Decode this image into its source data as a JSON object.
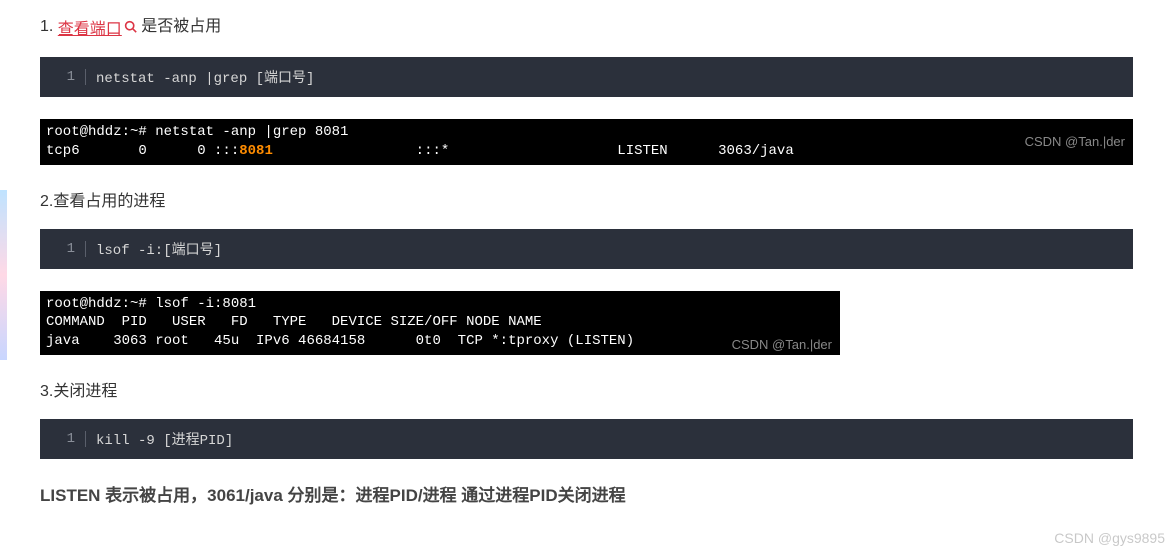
{
  "step1": {
    "num": "1. ",
    "link_text": "查看端口",
    "after_text": " 是否被占用",
    "icon_name": "search-icon"
  },
  "code1": {
    "lineno": "1",
    "code": "netstat -anp |grep [端口号]"
  },
  "term1": {
    "line1_prefix": "root@hddz:~# netstat -anp |grep 8081",
    "line2_before": "tcp6       0      0 :::",
    "line2_highlight": "8081",
    "line2_after": "                 :::*                    LISTEN      3063/java",
    "watermark": "CSDN @Tan.|der"
  },
  "step2": "2.查看占用的进程",
  "code2": {
    "lineno": "1",
    "code": "lsof -i:[端口号]"
  },
  "term2": {
    "line1": "root@hddz:~# lsof -i:8081",
    "line2": "COMMAND  PID   USER   FD   TYPE   DEVICE SIZE/OFF NODE NAME",
    "line3": "java    3063 root   45u  IPv6 46684158      0t0  TCP *:tproxy (LISTEN)",
    "watermark": "CSDN @Tan.|der"
  },
  "step3": "3.关闭进程",
  "code3": {
    "lineno": "1",
    "code": "kill -9 [进程PID]"
  },
  "summary": "LISTEN 表示被占用，3061/java 分别是：进程PID/进程 通过进程PID关闭进程",
  "page_watermark": "CSDN @gys9895"
}
